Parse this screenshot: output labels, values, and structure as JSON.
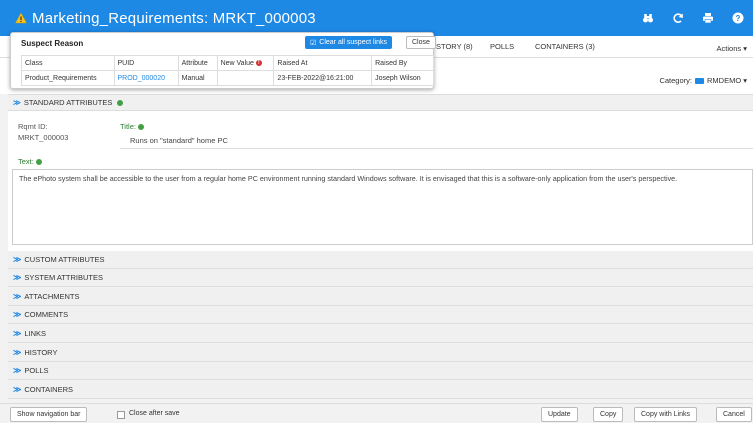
{
  "header": {
    "title": "Marketing_Requirements: MRKT_000003",
    "icons": [
      "binoculars-icon",
      "refresh-icon",
      "print-icon",
      "help-icon"
    ]
  },
  "tabs": [
    {
      "label": "STORY (8)"
    },
    {
      "label": "POLLS"
    },
    {
      "label": "CONTAINERS (3)"
    }
  ],
  "actions_label": "Actions ▾",
  "category": {
    "label": "Category:",
    "value": "RMDEMO ▾"
  },
  "suspect_popup": {
    "title": "Suspect Reason",
    "clear_label": "Clear all suspect links",
    "close_label": "Close",
    "columns": [
      "Class",
      "PUID",
      "Attribute",
      "New Value",
      "Raised At",
      "Raised By"
    ],
    "rows": [
      [
        "Product_Requirements",
        "PROD_000020",
        "Manual",
        "",
        "23-FEB-2022@16:21:00",
        "Joseph Wilson"
      ]
    ]
  },
  "standard_attributes": {
    "header": "STANDARD ATTRIBUTES",
    "rqmt_id_label": "Rqmt ID:",
    "rqmt_id_value": "MRKT_000003",
    "title_label": "Title:",
    "title_value": "Runs on \"standard\" home PC",
    "text_label": "Text:",
    "text_value": "The ePhoto system shall be accessible to the user from a regular home PC environment running standard Windows software. It is envisaged that this is a software-only application from the user's perspective."
  },
  "sections": [
    "CUSTOM ATTRIBUTES",
    "SYSTEM ATTRIBUTES",
    "ATTACHMENTS",
    "COMMENTS",
    "LINKS",
    "HISTORY",
    "POLLS",
    "CONTAINERS"
  ],
  "footer": {
    "show_nav_label": "Show navigation bar",
    "close_after_save_label": "Close after save",
    "update_label": "Update",
    "copy_label": "Copy",
    "copy_links_label": "Copy with Links",
    "cancel_label": "Cancel"
  },
  "colors": {
    "accent": "#1e88e5",
    "warning": "#f9c21a",
    "ok": "#43a047"
  }
}
